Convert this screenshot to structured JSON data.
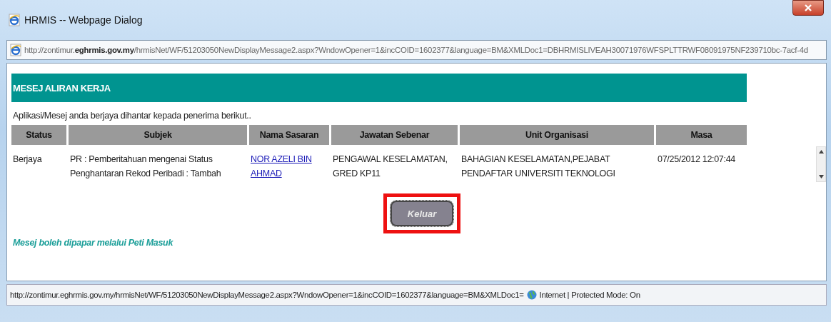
{
  "window": {
    "title": "HRMIS -- Webpage Dialog"
  },
  "address_bar": {
    "url": "http://zontimur.**eghrmis.gov.my**/hrmisNet/WF/51203050NewDisplayMessage2.aspx?WndowOpener=1&incCOID=1602377&language=BM&XMLDoc1=DBHRMISLIVEAH30071976WFSPLTTRWF08091975NF239710bc-7acf-4d"
  },
  "page": {
    "heading": "MESEJ ALIRAN KERJA",
    "intro": "Aplikasi/Mesej anda berjaya dihantar kepada penerima berikut..",
    "table": {
      "columns": [
        "Status",
        "Subjek",
        "Nama Sasaran",
        "Jawatan Sebenar",
        "Unit Organisasi",
        "Masa"
      ],
      "rows": [
        {
          "status": "Berjaya",
          "subject": "PR : Pemberitahuan mengenai Status Penghantaran Rekod Peribadi : Tambah",
          "target": "NOR AZELI BIN AHMAD",
          "position": "PENGAWAL KESELAMATAN, GRED KP11",
          "unit": "BAHAGIAN KESELAMATAN,PEJABAT PENDAFTAR UNIVERSITI TEKNOLOGI",
          "time": "07/25/2012 12:07:44"
        }
      ]
    },
    "button": {
      "label": "Keluar",
      "highlighted": true
    },
    "footer_note": "Mesej boleh dipapar melalui Peti Masuk"
  },
  "status_bar": {
    "url": "http://zontimur.eghrmis.gov.my/hrmisNet/WF/51203050NewDisplayMessage2.aspx?WndowOpener=1&incCOID=1602377&language=BM&XMLDoc1=",
    "zone": "Internet | Protected Mode: On"
  }
}
